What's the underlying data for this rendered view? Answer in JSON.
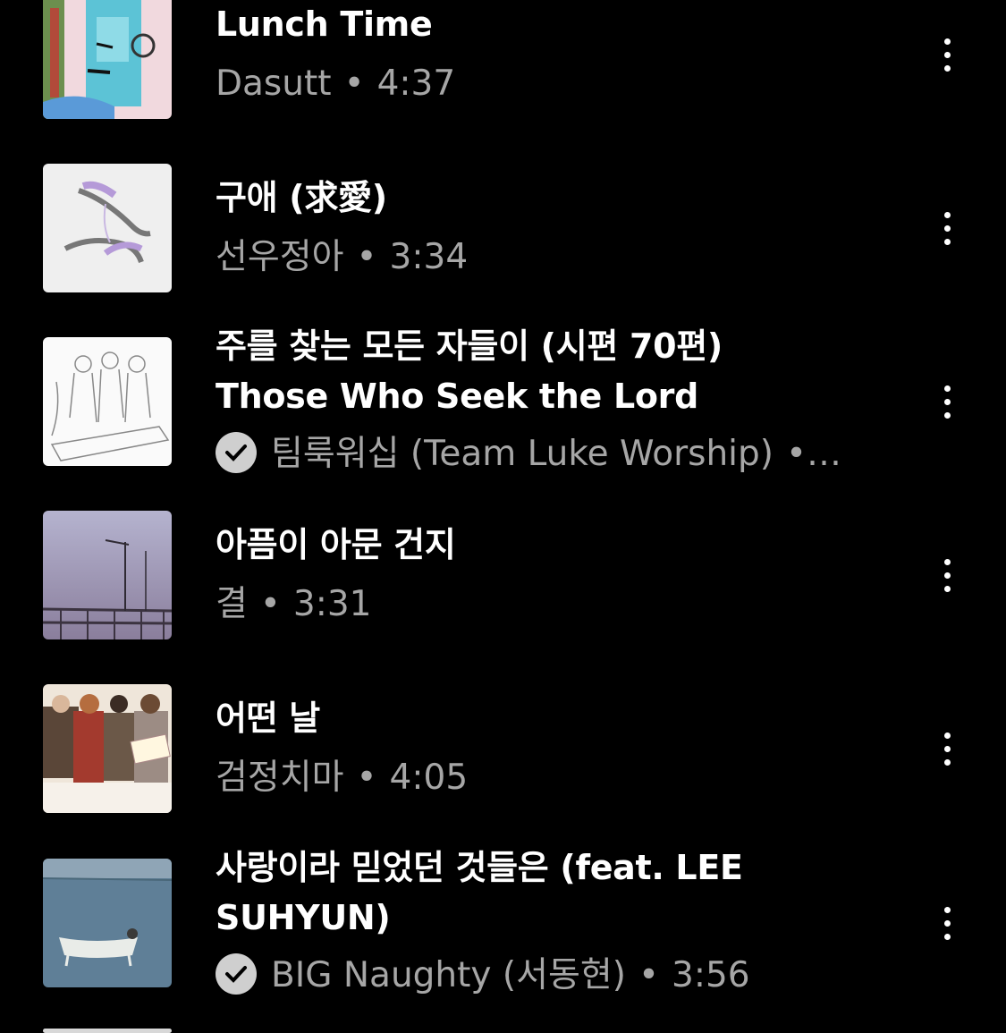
{
  "songs": [
    {
      "title": "Lunch Time",
      "artist": "Dasutt",
      "duration": "4:37",
      "verified": false,
      "thumb": "abstract-face-art"
    },
    {
      "title": "구애 (求愛)",
      "artist": "선우정아",
      "duration": "3:34",
      "verified": false,
      "thumb": "hands-sketch"
    },
    {
      "title_line1": "주를 찾는 모든 자들이 (시편 70편)",
      "title_line2": "Those Who Seek the Lord",
      "artist": "팀룩워십 (Team Luke Worship)",
      "separator": "•…",
      "verified": true,
      "thumb": "line-drawing-people"
    },
    {
      "title": "아픔이 아문 건지",
      "artist": "결",
      "duration": "3:31",
      "verified": false,
      "thumb": "pier-dusk-photo"
    },
    {
      "title": "어떤 날",
      "artist": "검정치마",
      "duration": "4:05",
      "verified": false,
      "thumb": "drama-cast-photo"
    },
    {
      "title_line1": "사랑이라 믿었던 것들은 (feat. LEE",
      "title_line2": "SUHYUN)",
      "artist": "BIG Naughty (서동현)",
      "duration": "3:56",
      "verified": true,
      "thumb": "bathtub-sea-photo"
    }
  ],
  "dot": "•"
}
